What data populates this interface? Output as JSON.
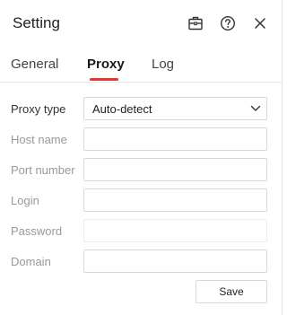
{
  "window": {
    "title": "Setting"
  },
  "titlebar": {
    "icons": [
      "briefcase-icon",
      "help-icon",
      "close-icon"
    ]
  },
  "tabs": [
    {
      "label": "General",
      "active": false
    },
    {
      "label": "Proxy",
      "active": true
    },
    {
      "label": "Log",
      "active": false
    }
  ],
  "colors": {
    "accent": "#e53935",
    "label_inactive": "#999999",
    "border": "#d9d9d9"
  },
  "form": {
    "proxy_type": {
      "label": "Proxy type",
      "value": "Auto-detect"
    },
    "host_name": {
      "label": "Host name",
      "value": ""
    },
    "port_number": {
      "label": "Port number",
      "value": ""
    },
    "login": {
      "label": "Login",
      "value": ""
    },
    "password": {
      "label": "Password",
      "value": ""
    },
    "domain": {
      "label": "Domain",
      "value": ""
    }
  },
  "buttons": {
    "save_label": "Save"
  }
}
